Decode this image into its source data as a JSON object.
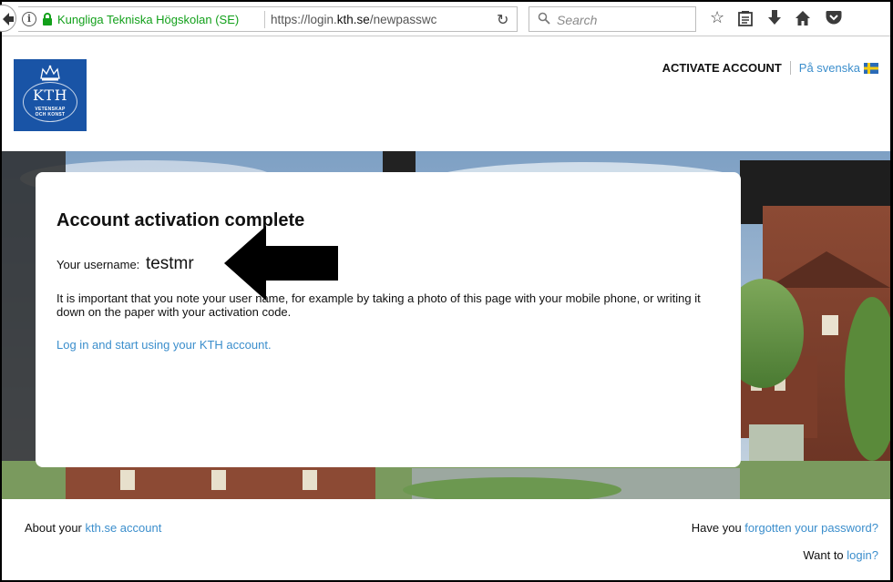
{
  "browser": {
    "identity": "Kungliga Tekniska Högskolan (SE)",
    "url_prefix": "https://login.",
    "url_domain": "kth.se",
    "url_path": "/newpasswc",
    "search_placeholder": "Search"
  },
  "header": {
    "active_nav": "ACTIVATE ACCOUNT",
    "language_link": "På svenska"
  },
  "logo": {
    "letters": "KTH",
    "motto_line1": "VETENSKAP",
    "motto_line2": "OCH KONST"
  },
  "card": {
    "title": "Account activation complete",
    "username_label": "Your username:",
    "username_value": "testmr",
    "notice": "It is important that you note your user name, for example by taking a photo of this page with your mobile phone, or writing it down on the paper with your activation code.",
    "login_link": "Log in and start using your KTH account."
  },
  "footer": {
    "about_prefix": "About your",
    "about_link": "kth.se account",
    "forgot_prefix": "Have you",
    "forgot_link": "forgotten your password?",
    "login_prefix": "Want to",
    "login_link": "login?"
  },
  "colors": {
    "kth_blue": "#1954a6",
    "link": "#3b8ecc",
    "secure_green": "#12a01a"
  },
  "icons": [
    "back-icon",
    "info-icon",
    "lock-icon",
    "reload-icon",
    "search-icon",
    "bookmark-star-icon",
    "reading-list-icon",
    "download-icon",
    "home-icon",
    "pocket-icon",
    "swedish-flag-icon",
    "arrow-annotation"
  ]
}
